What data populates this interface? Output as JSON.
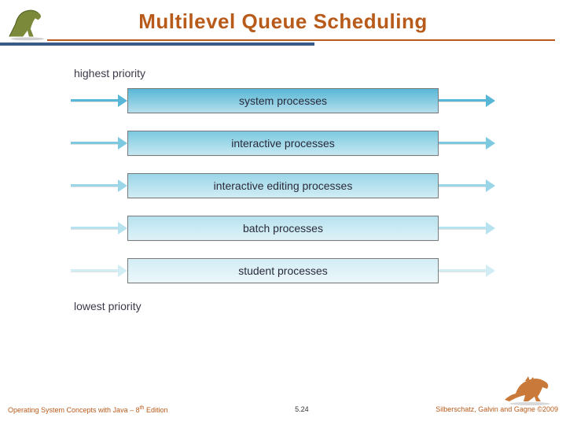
{
  "title": "Multilevel Queue Scheduling",
  "labels": {
    "top": "highest priority",
    "bottom": "lowest priority"
  },
  "queues": [
    {
      "name": "system processes",
      "color": "#58b7d6"
    },
    {
      "name": "interactive processes",
      "color": "#7cc9e0"
    },
    {
      "name": "interactive editing processes",
      "color": "#9ad6e8"
    },
    {
      "name": "batch processes",
      "color": "#b7e2ef"
    },
    {
      "name": "student processes",
      "color": "#d3edf5"
    }
  ],
  "footer": {
    "left_a": "Operating System Concepts with Java – 8",
    "left_sup": "th",
    "left_b": " Edition",
    "center": "5.24",
    "right": "Silberschatz, Galvin and Gagne ©2009"
  },
  "icons": {
    "dino_left": "dinosaur-icon",
    "dino_right": "dinosaur-icon"
  }
}
